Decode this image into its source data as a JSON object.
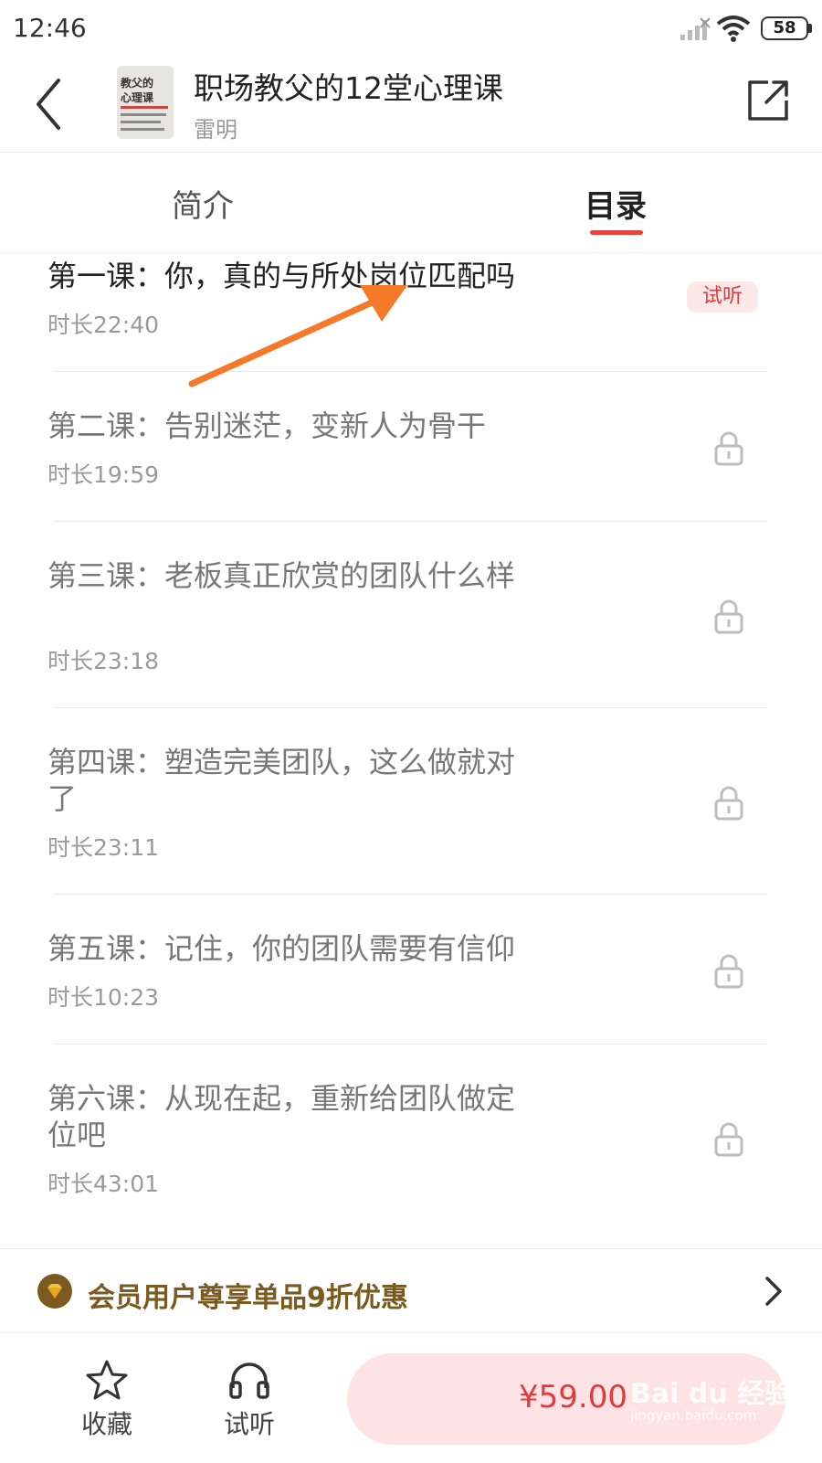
{
  "status_bar": {
    "time": "12:46",
    "battery": "58"
  },
  "header": {
    "title": "职场教父的12堂心理课",
    "author": "雷明",
    "cover_line1": "教父的",
    "cover_line2": "心理课"
  },
  "tabs": {
    "intro": "简介",
    "catalog": "目录"
  },
  "lessons": [
    {
      "title": "第一课：你，真的与所处岗位匹配吗",
      "duration": "时长22:40",
      "badge": "试听"
    },
    {
      "title": "第二课：告别迷茫，变新人为骨干",
      "duration": "时长19:59"
    },
    {
      "title": "第三课：老板真正欣赏的团队什么样",
      "duration": "时长23:18"
    },
    {
      "title": "第四课：塑造完美团队，这么做就对了",
      "duration": "时长23:11"
    },
    {
      "title": "第五课：记住，你的团队需要有信仰",
      "duration": "时长10:23"
    },
    {
      "title": "第六课：从现在起，重新给团队做定位吧",
      "duration": "时长43:01"
    }
  ],
  "vip": {
    "text": "会员用户尊享单品9折优惠"
  },
  "bottom": {
    "favorite_label": "收藏",
    "trial_label": "试听",
    "price": "¥59.00"
  },
  "watermark": {
    "main": "Bai du 经验",
    "sub": "jingyan.baidu.com"
  },
  "colors": {
    "accent": "#e4393c",
    "vip_gold": "#7a5a1e",
    "buy_bg": "#fde3e3",
    "arrow": "#f47a2a"
  }
}
